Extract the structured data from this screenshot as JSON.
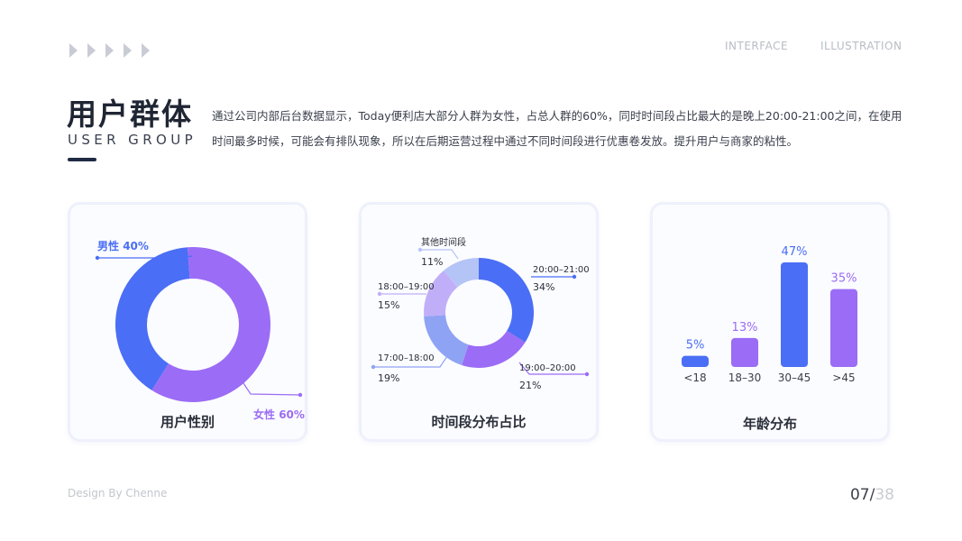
{
  "nav": {
    "link1": "INTERFACE",
    "link2": "ILLUSTRATION"
  },
  "header": {
    "title_cn": "用户群体",
    "title_en": "USER GROUP",
    "description": "通过公司内部后台数据显示，Today便利店大部分人群为女性，占总人群的60%，同时时间段占比最大的是晚上20:00-21:00之间，在使用时间最多时候，可能会有排队现象，所以在后期运营过程中通过不同时间段进行优惠卷发放。提升用户与商家的粘性。"
  },
  "colors": {
    "blue": "#4a6ef5",
    "purple": "#9b6cf6",
    "light_blue": "#8fa3f4",
    "lavender": "#c1aef8",
    "pale_blue": "#b5c4f7"
  },
  "chart_data": [
    {
      "type": "pie",
      "title": "用户性别",
      "slices": [
        {
          "label": "男性",
          "value": 40,
          "value_label": "40%",
          "color": "#4a6ef5"
        },
        {
          "label": "女性",
          "value": 60,
          "value_label": "60%",
          "color": "#9b6cf6"
        }
      ]
    },
    {
      "type": "pie",
      "title": "时间段分布占比",
      "slices": [
        {
          "label": "20:00–21:00",
          "value": 34,
          "value_label": "34%",
          "color": "#4a6ef5"
        },
        {
          "label": "19:00–20:00",
          "value": 21,
          "value_label": "21%",
          "color": "#9b6cf6"
        },
        {
          "label": "17:00–18:00",
          "value": 19,
          "value_label": "19%",
          "color": "#8fa3f4"
        },
        {
          "label": "18:00–19:00",
          "value": 15,
          "value_label": "15%",
          "color": "#c1aef8"
        },
        {
          "label": "其他时间段",
          "value": 11,
          "value_label": "11%",
          "color": "#b5c4f7"
        }
      ]
    },
    {
      "type": "bar",
      "title": "年龄分布",
      "categories": [
        "<18",
        "18–30",
        "30–45",
        ">45"
      ],
      "values": [
        5,
        13,
        47,
        35
      ],
      "value_labels": [
        "5%",
        "13%",
        "47%",
        "35%"
      ],
      "colors": [
        "#4a6ef5",
        "#9b6cf6",
        "#4a6ef5",
        "#9b6cf6"
      ]
    }
  ],
  "footer": {
    "credit": "Design By Chenne",
    "page_current": "07",
    "page_sep": "/",
    "page_total": "38"
  }
}
